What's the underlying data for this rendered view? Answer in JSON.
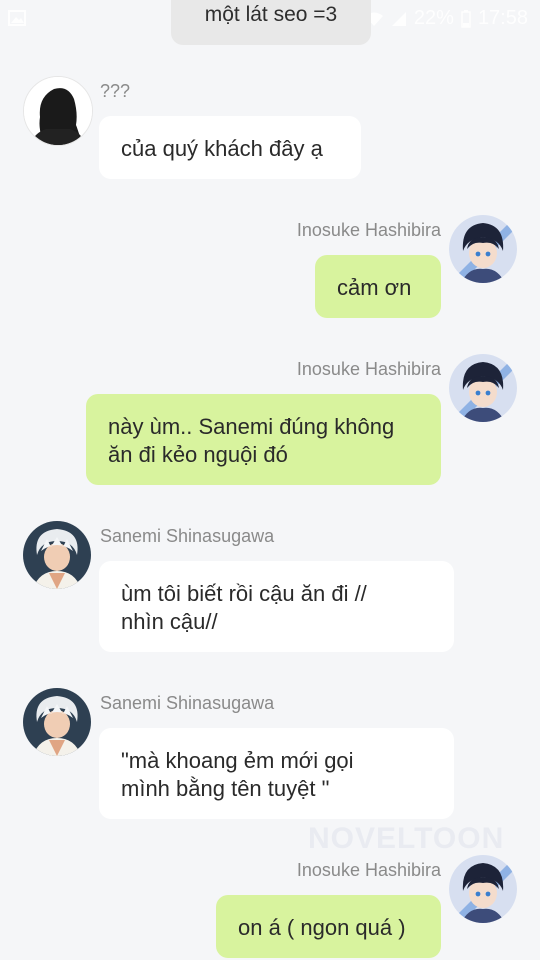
{
  "status_bar": {
    "battery": "22%",
    "time": "17:58",
    "icons": [
      "image-icon",
      "mute-icon",
      "wifi-icon",
      "signal-icon",
      "battery-icon"
    ]
  },
  "top_message": {
    "text": "một lát seo =3"
  },
  "messages": [
    {
      "sender": "???",
      "side": "left",
      "lines": [
        "của quý khách đây ạ"
      ]
    },
    {
      "sender": "Inosuke Hashibira",
      "side": "right",
      "lines": [
        "cảm ơn"
      ]
    },
    {
      "sender": "Inosuke Hashibira",
      "side": "right",
      "lines": [
        "này ùm.. Sanemi đúng không",
        "ăn đi kẻo nguội đó"
      ]
    },
    {
      "sender": "Sanemi Shinasugawa",
      "side": "left",
      "lines": [
        "ùm tôi biết rồi cậu ăn đi //",
        "nhìn cậu//"
      ]
    },
    {
      "sender": "Sanemi Shinasugawa",
      "side": "left",
      "lines": [
        "\"mà khoang ẻm mới gọi",
        "mình bằng tên tuyệt \""
      ]
    },
    {
      "sender": "Inosuke Hashibira",
      "side": "right",
      "lines": [
        "on á ( ngon quá )"
      ]
    }
  ],
  "watermark": "NOVELTOON",
  "colors": {
    "background": "#f5f6f8",
    "bubble_self": "#d8f39e",
    "bubble_other": "#ffffff",
    "name_text": "#8a8a8a"
  }
}
